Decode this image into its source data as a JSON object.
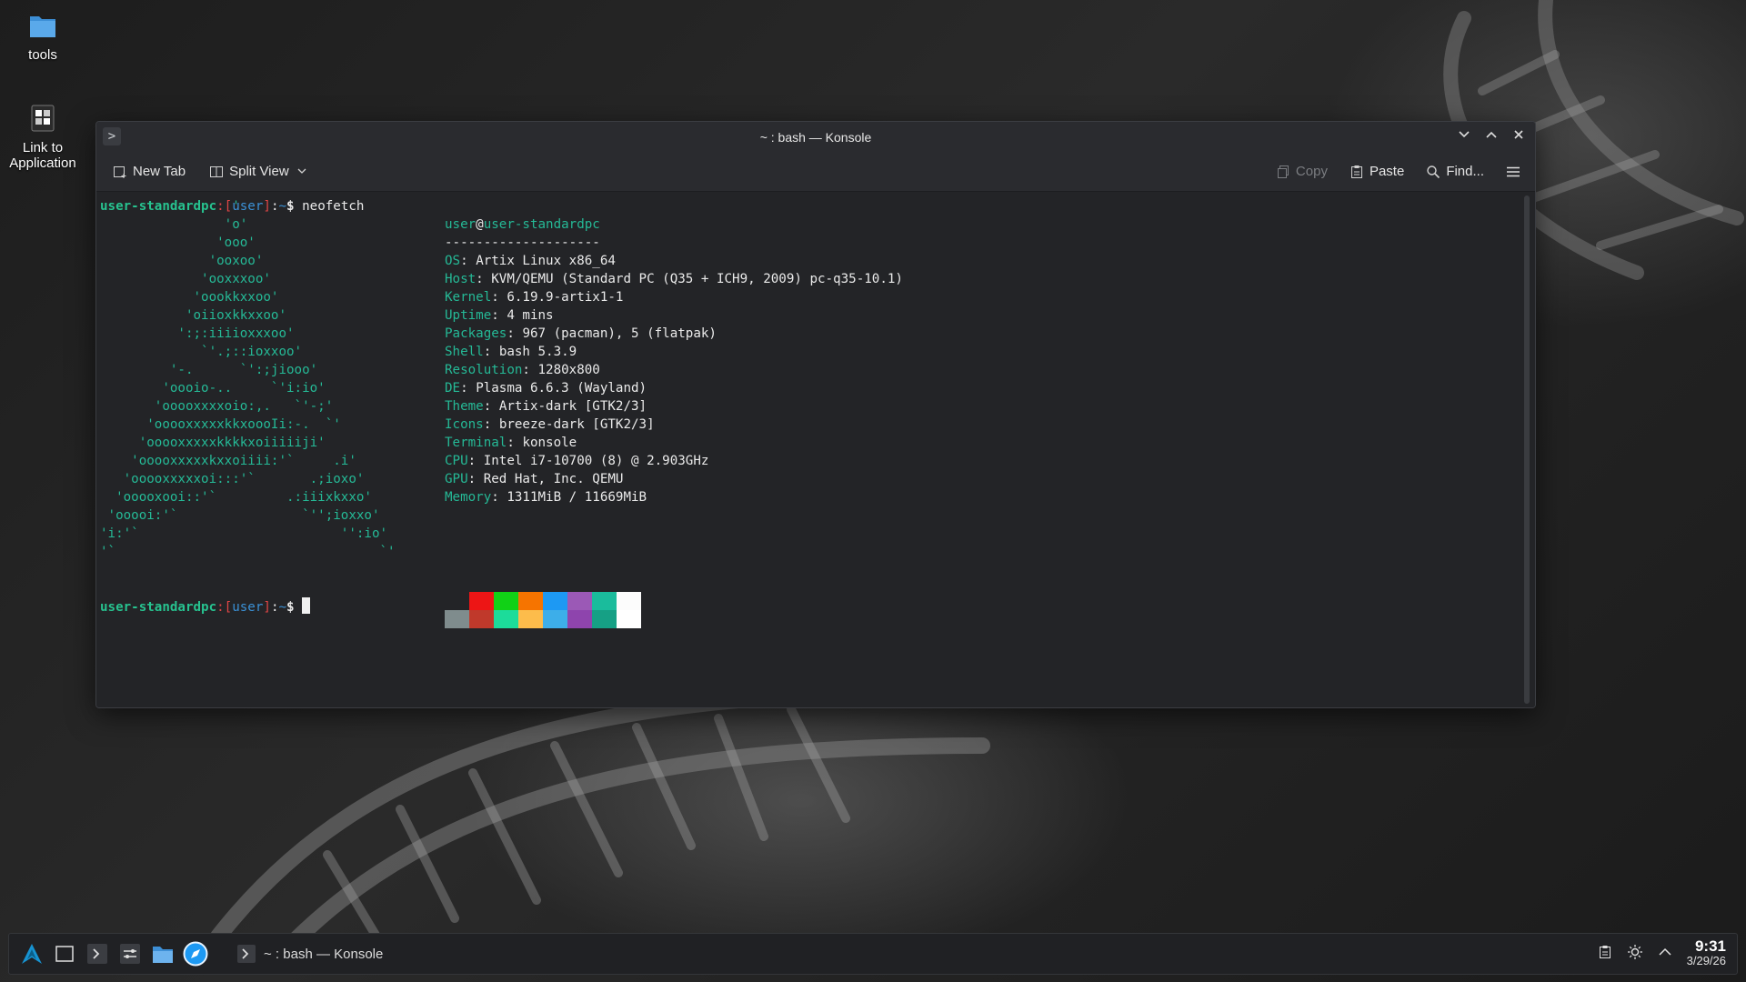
{
  "desktop": {
    "icons": [
      {
        "label": "tools",
        "icon": "folder-icon"
      },
      {
        "label": "Link to Application",
        "icon": "application-link-icon"
      }
    ]
  },
  "window": {
    "title": "~ : bash — Konsole",
    "toolbar": {
      "new_tab": "New Tab",
      "split_view": "Split View",
      "copy": "Copy",
      "paste": "Paste",
      "find": "Find..."
    }
  },
  "terminal": {
    "prompt_host": "user-standardpc",
    "prompt_user": "user",
    "prompt_path": "~",
    "prompt_symbol": "$",
    "command": "neofetch",
    "logo_lines": [
      "                 '",
      "                'o'",
      "               'ooo'",
      "              'ooxoo'",
      "             'ooxxxoo'",
      "            'oookkxxoo'",
      "           'oiioxkkxxoo'",
      "          ':;:iiiioxxxoo'",
      "             `'.;::ioxxoo'",
      "         '-.      `':;jiooo'",
      "        'oooio-..     `'i:io'",
      "       'ooooxxxxoio:,.   `'-;'",
      "      'ooooxxxxxkkxoooIi:-.  `'",
      "     'ooooxxxxxkkkkxoiiiiiji'",
      "    'ooooxxxxxkxxoiiii:'`     .i'",
      "   'ooooxxxxxoi:::'`       .;ioxo'",
      "  'ooooxooi::'`         .:iiixkxxo'",
      " 'ooooi:'`                `'';ioxxo'",
      "'i:'`                          '':io'",
      "'`                                  `'"
    ],
    "user_host_user": "user",
    "user_host_at": "@",
    "user_host_host": "user-standardpc",
    "separator": "--------------------",
    "info": [
      {
        "key": "OS",
        "value": "Artix Linux x86_64"
      },
      {
        "key": "Host",
        "value": "KVM/QEMU (Standard PC (Q35 + ICH9, 2009) pc-q35-10.1)"
      },
      {
        "key": "Kernel",
        "value": "6.19.9-artix1-1"
      },
      {
        "key": "Uptime",
        "value": "4 mins"
      },
      {
        "key": "Packages",
        "value": "967 (pacman), 5 (flatpak)"
      },
      {
        "key": "Shell",
        "value": "bash 5.3.9"
      },
      {
        "key": "Resolution",
        "value": "1280x800"
      },
      {
        "key": "DE",
        "value": "Plasma 6.6.3 (Wayland)"
      },
      {
        "key": "Theme",
        "value": "Artix-dark [GTK2/3]"
      },
      {
        "key": "Icons",
        "value": "breeze-dark [GTK2/3]"
      },
      {
        "key": "Terminal",
        "value": "konsole"
      },
      {
        "key": "CPU",
        "value": "Intel i7-10700 (8) @ 2.903GHz"
      },
      {
        "key": "GPU",
        "value": "Red Hat, Inc. QEMU"
      },
      {
        "key": "Memory",
        "value": "1311MiB / 11669MiB"
      }
    ],
    "palette_top": [
      "#232427",
      "#ed1515",
      "#11d116",
      "#f67400",
      "#1d99f3",
      "#9b59b6",
      "#1abc9c",
      "#fcfcfc"
    ],
    "palette_bottom": [
      "#7f8c8d",
      "#c0392b",
      "#1cdc9a",
      "#fdbc4b",
      "#3daee9",
      "#8e44ad",
      "#16a085",
      "#ffffff"
    ]
  },
  "taskbar": {
    "task_label": "~ : bash — Konsole",
    "time": "9:31",
    "date": "3/29/26",
    "launchers": [
      "artix-logo-icon",
      "show-desktop-icon",
      "terminal-icon",
      "settings-icon",
      "file-manager-icon",
      "browser-icon"
    ]
  }
}
